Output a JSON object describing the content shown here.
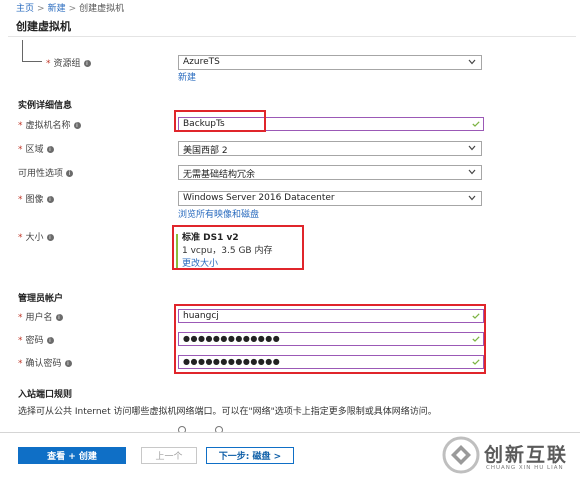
{
  "breadcrumb": {
    "home": "主页",
    "new": "新建",
    "current": "创建虚拟机",
    "sep": ">"
  },
  "page": {
    "title": "创建虚拟机"
  },
  "resource_group": {
    "label": "资源组",
    "value": "AzureTS",
    "new_link": "新建"
  },
  "instance": {
    "heading": "实例详细信息",
    "vm_name": {
      "label": "虚拟机名称",
      "value": "BackupTs"
    },
    "region": {
      "label": "区域",
      "value": "美国西部 2"
    },
    "availability": {
      "label": "可用性选项",
      "value": "无需基础结构冗余"
    },
    "image": {
      "label": "图像",
      "value": "Windows Server 2016 Datacenter",
      "browse_link": "浏览所有映像和磁盘"
    },
    "size": {
      "label": "大小",
      "name": "标准 DS1 v2",
      "spec": "1 vcpu，3.5 GB 内存",
      "change_link": "更改大小"
    }
  },
  "admin": {
    "heading": "管理员帐户",
    "username": {
      "label": "用户名",
      "value": "huangcj"
    },
    "password": {
      "label": "密码",
      "value": "●●●●●●●●●●●●●"
    },
    "confirm": {
      "label": "确认密码",
      "value": "●●●●●●●●●●●●●"
    }
  },
  "inbound": {
    "heading": "入站端口规则",
    "desc": "选择可从公共 Internet 访问哪些虚拟机网络端口。可以在\"网络\"选项卡上指定更多限制或具体网络访问。"
  },
  "footer": {
    "review_create": "查看 + 创建",
    "previous": "上一个",
    "next": "下一步: 磁盘 >"
  },
  "watermark": {
    "name": "创新互联",
    "sub": "CHUANG XIN HU LIAN"
  },
  "info_glyph": "i",
  "colors": {
    "link": "#2b6cbf",
    "primary": "#0f6fc6",
    "highlight": "#e0252b",
    "valid": "#8bbd3c",
    "input_border": "#9b59b6"
  }
}
